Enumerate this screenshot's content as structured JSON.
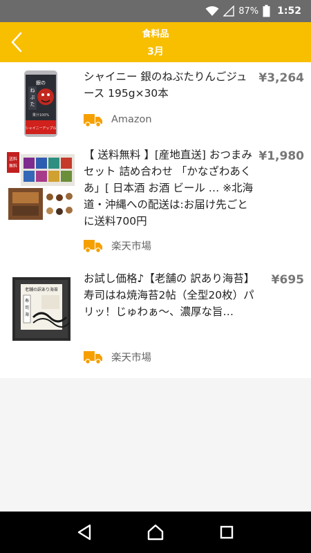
{
  "status_bar": {
    "battery": "87%",
    "time": "1:52"
  },
  "header": {
    "title": "食料品",
    "subtitle": "3月"
  },
  "items": [
    {
      "title": "シャイニー 銀のねぶたりんごジュース 195g×30本",
      "price": "¥3,264",
      "shop": "Amazon"
    },
    {
      "title": "【 送料無料 】[産地直送] おつまみセット 詰め合わせ 「かなざわあくあ」[ 日本酒 お酒 ビール … ※北海道・沖縄への配送は:お届け先ごとに送料700円",
      "price": "¥1,980",
      "shop": "楽天市場"
    },
    {
      "title": "お試し価格♪【老舗の 訳あり海苔】寿司はね焼海苔2帖（全型20枚）パリッ！じゅわぁ〜、濃厚な旨…",
      "price": "¥695",
      "shop": "楽天市場"
    }
  ],
  "colors": {
    "header": "#f8be00",
    "truck": "#f5a000",
    "price": "#777777"
  },
  "icons": {
    "back": "chevron-left-icon",
    "delivery": "truck-icon",
    "wifi": "wifi-icon",
    "signal": "signal-icon",
    "battery": "battery-icon"
  }
}
